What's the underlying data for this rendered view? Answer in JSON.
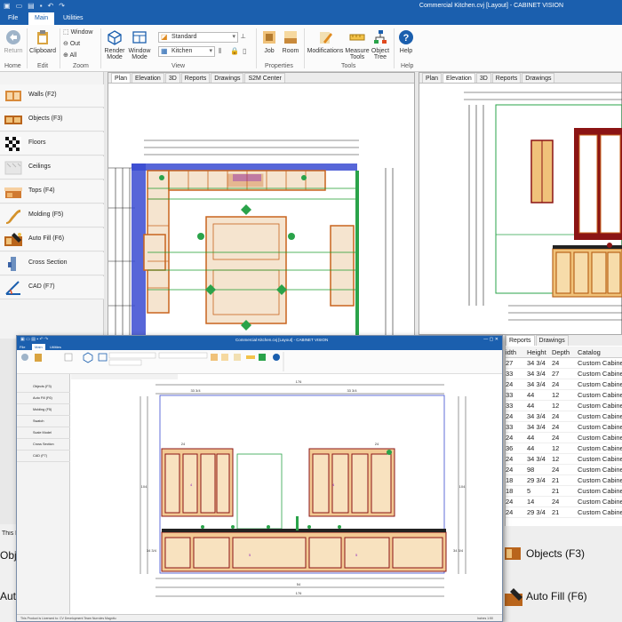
{
  "window": {
    "title": "Commercial Kitchen.cvj [Layout] - CABINET VISION"
  },
  "menu": {
    "file": "File",
    "main": "Main",
    "utilities": "Utilities"
  },
  "ribbon": {
    "return": "Return",
    "clipboard": "Clipboard",
    "window": "Window",
    "out": "Out",
    "all": "All",
    "render_mode": "Render Mode",
    "window_mode": "Window Mode",
    "view_combo_1": "Standard",
    "view_combo_2": "Kitchen",
    "job": "Job",
    "room": "Room",
    "modifications": "Modifications",
    "measure_tools": "Measure Tools",
    "object_tree": "Object Tree",
    "help": "Help",
    "groups": {
      "home": "Home",
      "edit": "Edit",
      "zoom": "Zoom",
      "view": "View",
      "properties": "Properties",
      "tools": "Tools",
      "help": "Help"
    }
  },
  "sidebar": {
    "items": [
      {
        "label": "Walls (F2)"
      },
      {
        "label": "Objects (F3)"
      },
      {
        "label": "Floors"
      },
      {
        "label": "Ceilings"
      },
      {
        "label": "Tops (F4)"
      },
      {
        "label": "Molding (F5)"
      },
      {
        "label": "Auto Fill (F6)"
      },
      {
        "label": "Cross Section"
      },
      {
        "label": "CAD (F7)"
      }
    ]
  },
  "left_tabs": [
    "Plan",
    "Elevation",
    "3D",
    "Reports",
    "Drawings",
    "S2M Center"
  ],
  "right_tabs": [
    "Plan",
    "Elevation",
    "3D",
    "Reports",
    "Drawings"
  ],
  "grid_tabs": [
    "Reports",
    "Drawings"
  ],
  "grid": {
    "headers": [
      "idth",
      "Height",
      "Depth",
      "Catalog"
    ],
    "rows": [
      [
        "27",
        "34 3/4",
        "24",
        "Custom Cabinet"
      ],
      [
        "33",
        "34 3/4",
        "27",
        "Custom Cabinet"
      ],
      [
        "24",
        "34 3/4",
        "24",
        "Custom Cabinet"
      ],
      [
        "33",
        "44",
        "12",
        "Custom Cabinet"
      ],
      [
        "33",
        "44",
        "12",
        "Custom Cabinet"
      ],
      [
        "24",
        "34 3/4",
        "24",
        "Custom Cabinet"
      ],
      [
        "33",
        "34 3/4",
        "24",
        "Custom Cabinet"
      ],
      [
        "24",
        "44",
        "24",
        "Custom Cabinet"
      ],
      [
        "36",
        "44",
        "12",
        "Custom Cabinet"
      ],
      [
        "24",
        "34 3/4",
        "12",
        "Custom Cabinet"
      ],
      [
        "24",
        "98",
        "24",
        "Custom Cabinet"
      ],
      [
        "18",
        "29 3/4",
        "21",
        "Custom Cabinet"
      ],
      [
        "18",
        "5",
        "21",
        "Custom Cabinet"
      ],
      [
        "24",
        "14",
        "24",
        "Custom Cabinet"
      ],
      [
        "24",
        "29 3/4",
        "21",
        "Custom Cabinet"
      ]
    ]
  },
  "bottom": {
    "objects": "Objects (F3)",
    "autofill": "Auto Fill (F6)",
    "obje": "Obje",
    "auto": "Auto",
    "this": "This F"
  },
  "overlay": {
    "title": "Commercial Kitchen.cvj [Layout] - CABINET VISION",
    "menu": [
      "File",
      "Main",
      "Utilities"
    ],
    "side_items": [
      "Objects (F3)",
      "Auto Fill (F6)",
      "Molding (F5)",
      "Swatch",
      "Scale Model",
      "Cross Section",
      "CAD (F7)"
    ],
    "status": "This Product is Licensed to:    CV Development Team                           Nurroles Magnitu",
    "zoom": "Inches  1:50",
    "dims": {
      "top_overall": "176",
      "upper_left": "33 3/4",
      "upper_right": "33 3/4",
      "tall_left": "24",
      "tall_right": "24",
      "base_left_height": "34 3/4",
      "base_right_height": "34 3/4",
      "bottom_total": "176",
      "bottom_middle": "54",
      "left_height": "104",
      "right_height": "104"
    }
  },
  "colors": {
    "brand": "#1b5fae",
    "cabinet": "#c8641e",
    "dimension": "#1e9b2c",
    "wall": "#3a4bd1",
    "annot": "#8a1fbf"
  }
}
